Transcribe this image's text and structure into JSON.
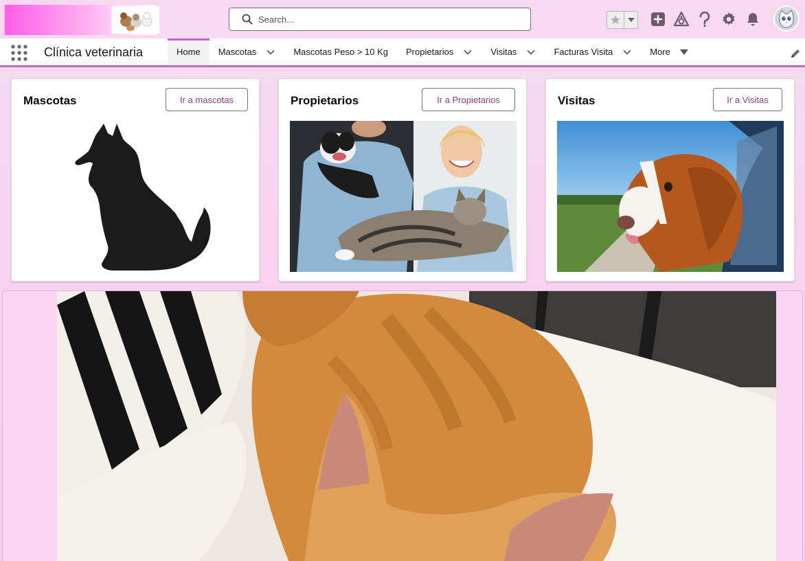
{
  "search": {
    "placeholder": "Search..."
  },
  "app": {
    "name": "Clínica veterinaria"
  },
  "nav": {
    "items": [
      {
        "label": "Home",
        "active": true,
        "has_menu": false
      },
      {
        "label": "Mascotas",
        "active": false,
        "has_menu": true
      },
      {
        "label": "Mascotas Peso > 10 Kg",
        "active": false,
        "has_menu": false
      },
      {
        "label": "Propietarios",
        "active": false,
        "has_menu": true
      },
      {
        "label": "Visitas",
        "active": false,
        "has_menu": true
      },
      {
        "label": "Facturas Visita",
        "active": false,
        "has_menu": true
      }
    ],
    "more_label": "More"
  },
  "header_icons": [
    "favorites-star-icon",
    "favorites-menu-icon",
    "global-actions-add-icon",
    "trailhead-icon",
    "help-icon",
    "setup-gear-icon",
    "notifications-bell-icon",
    "user-avatar"
  ],
  "cards": [
    {
      "title": "Mascotas",
      "button": "Ir a mascotas",
      "image": "dog-silhouette"
    },
    {
      "title": "Propietarios",
      "button": "Ir a Propietarios",
      "image": "owners-with-pets-photo"
    },
    {
      "title": "Visitas",
      "button": "Ir a Visitas",
      "image": "dog-in-car-window-photo"
    }
  ],
  "hero": {
    "image": "sleeping-orange-cat-photo"
  },
  "colors": {
    "header_bg": "#f8d8f1",
    "brand_gradient_start": "#ff5ee8",
    "nav_accent": "#c565c6",
    "button_text": "#8f3a8f",
    "page_bg": "#f6cff0",
    "icon_gray": "#6b5b6b"
  }
}
